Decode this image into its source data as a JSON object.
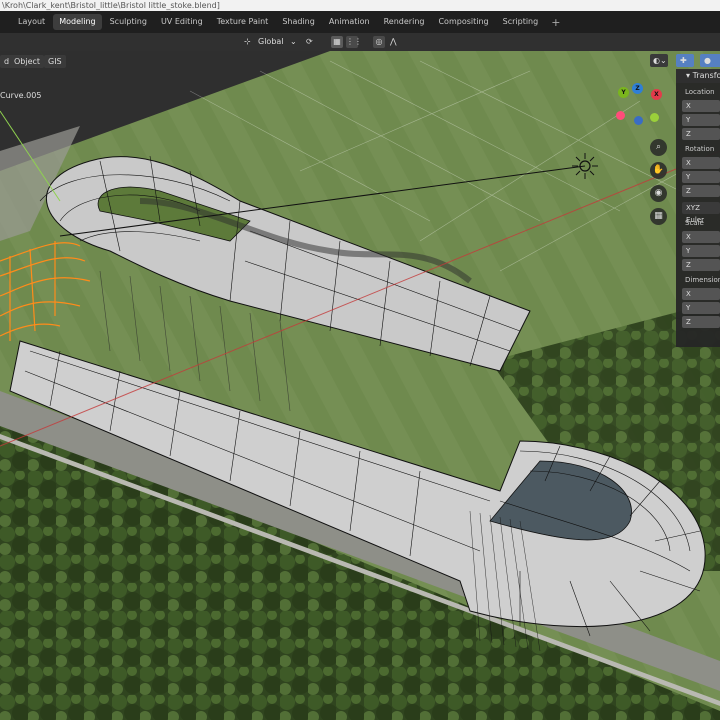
{
  "window": {
    "title": "\\Kroh\\Clark_kent\\Bristol_little\\Bristol little_stoke.blend]"
  },
  "workspace_tabs": [
    {
      "label": "Layout",
      "active": false
    },
    {
      "label": "Modeling",
      "active": true
    },
    {
      "label": "Sculpting",
      "active": false
    },
    {
      "label": "UV Editing",
      "active": false
    },
    {
      "label": "Texture Paint",
      "active": false
    },
    {
      "label": "Shading",
      "active": false
    },
    {
      "label": "Animation",
      "active": false
    },
    {
      "label": "Rendering",
      "active": false
    },
    {
      "label": "Compositing",
      "active": false
    },
    {
      "label": "Scripting",
      "active": false
    }
  ],
  "add_workspace_label": "+",
  "toolbar": {
    "orientation": "Global"
  },
  "viewport_header": {
    "menu_d": "d",
    "menu_object": "Object",
    "menu_gis": "GIS"
  },
  "active_object": "Curve.005",
  "gizmo": {
    "x_label": "X",
    "y_label": "Y",
    "z_label": "Z",
    "x_color": "#e23b4a",
    "y_color": "#7ab51d",
    "z_color": "#2f7fd6"
  },
  "sidebar": {
    "panel_title": "Transform",
    "location_label": "Location",
    "rotation_label": "Rotation",
    "rotation_mode": "XYZ Euler",
    "scale_label": "Scale",
    "dimensions_label": "Dimensions",
    "axis": [
      "X",
      "Y",
      "Z"
    ]
  },
  "colors": {
    "accent": "#5680c2",
    "selection": "#ff8c1a",
    "wire": "#101010"
  }
}
